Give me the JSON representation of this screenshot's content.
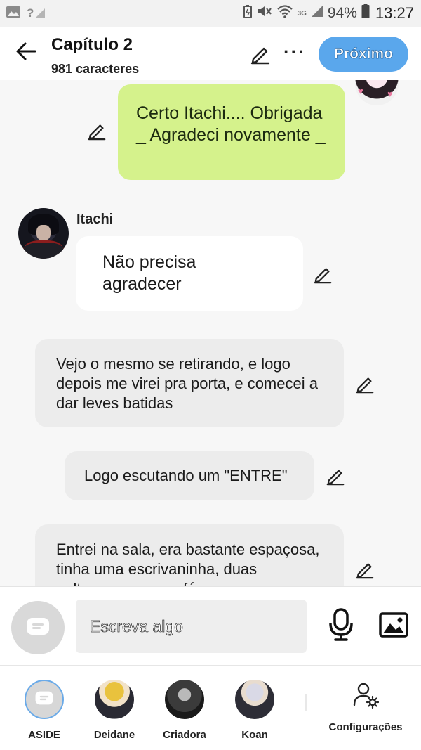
{
  "status_bar": {
    "left_text": "?",
    "network": "3G",
    "battery": "94%",
    "time": "13:27"
  },
  "header": {
    "title": "Capítulo 2",
    "subtitle": "981 caracteres",
    "more": "···",
    "next_label": "Próximo"
  },
  "messages": [
    {
      "type": "narration-green",
      "text": "Certo Itachi.... Obrigada _ Agradeci novamente _"
    },
    {
      "type": "character",
      "speaker": "Itachi",
      "text": "Não precisa agradecer"
    },
    {
      "type": "narration",
      "text": "Vejo o mesmo se retirando, e logo depois me virei pra porta, e comecei a dar leves batidas"
    },
    {
      "type": "narration",
      "text": "Logo escutando um \"ENTRE\""
    },
    {
      "type": "narration",
      "text": "Entrei na sala, era bastante espaçosa, tinha uma escrivaninha, duas poltronas, e um sofá"
    }
  ],
  "composer": {
    "placeholder": "Escreva algo"
  },
  "characters": [
    {
      "name": "ASIDE"
    },
    {
      "name": "Deidane"
    },
    {
      "name": "Criadora"
    },
    {
      "name": "Koan"
    }
  ],
  "settings_label": "Configurações",
  "colors": {
    "accent": "#5aa7ec",
    "narration_green": "#d5f28c",
    "bubble_grey": "#ececec"
  }
}
